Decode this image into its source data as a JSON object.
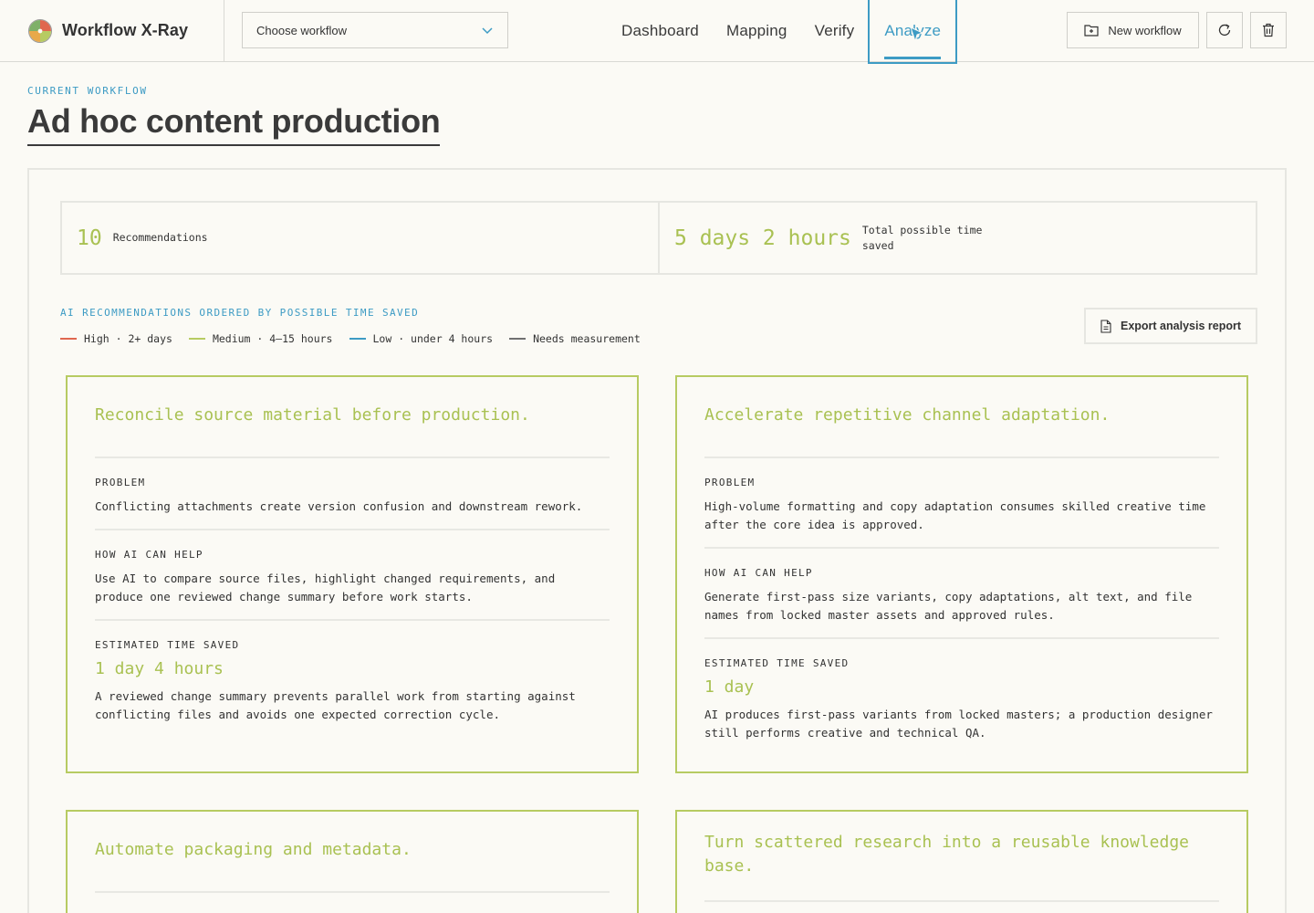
{
  "app": {
    "name": "Workflow X-Ray"
  },
  "workflow_select": {
    "value": "Choose workflow"
  },
  "nav": {
    "items": [
      {
        "label": "Dashboard",
        "active": false
      },
      {
        "label": "Mapping",
        "active": false
      },
      {
        "label": "Verify",
        "active": false
      },
      {
        "label": "Analyze",
        "active": true
      }
    ]
  },
  "toolbar": {
    "new_workflow": "New workflow"
  },
  "header": {
    "eyebrow": "CURRENT WORKFLOW",
    "title": "Ad hoc content production"
  },
  "stats": {
    "recommendations_count": "10",
    "recommendations_label": "Recommendations",
    "time_saved_value": "5 days 2 hours",
    "time_saved_label": "Total possible time saved"
  },
  "section": {
    "title": "AI RECOMMENDATIONS ORDERED BY POSSIBLE TIME SAVED",
    "export_label": "Export analysis report"
  },
  "legend": [
    {
      "label": "High · 2+ days",
      "color": "#e0674f"
    },
    {
      "label": "Medium · 4–15 hours",
      "color": "#b7cb62"
    },
    {
      "label": "Low · under 4 hours",
      "color": "#3d9bc4"
    },
    {
      "label": "Needs measurement",
      "color": "#707070"
    }
  ],
  "labels": {
    "problem": "PROBLEM",
    "how_ai": "HOW AI CAN HELP",
    "estimated": "ESTIMATED TIME SAVED"
  },
  "cards": [
    {
      "title": "Reconcile source material before production.",
      "problem": "Conflicting attachments create version confusion and downstream rework.",
      "help": "Use AI to compare source files, highlight changed requirements, and produce one reviewed change summary before work starts.",
      "time_saved": "1 day 4 hours",
      "time_note": "A reviewed change summary prevents parallel work from starting against conflicting files and avoids one expected correction cycle."
    },
    {
      "title": "Accelerate repetitive channel adaptation.",
      "problem": "High-volume formatting and copy adaptation consumes skilled creative time after the core idea is approved.",
      "help": "Generate first-pass size variants, copy adaptations, alt text, and file names from locked master assets and approved rules.",
      "time_saved": "1 day",
      "time_note": "AI produces first-pass variants from locked masters; a production designer still performs creative and technical QA."
    },
    {
      "title": "Automate packaging and metadata."
    },
    {
      "title": "Turn scattered research into a reusable knowledge base."
    }
  ]
}
